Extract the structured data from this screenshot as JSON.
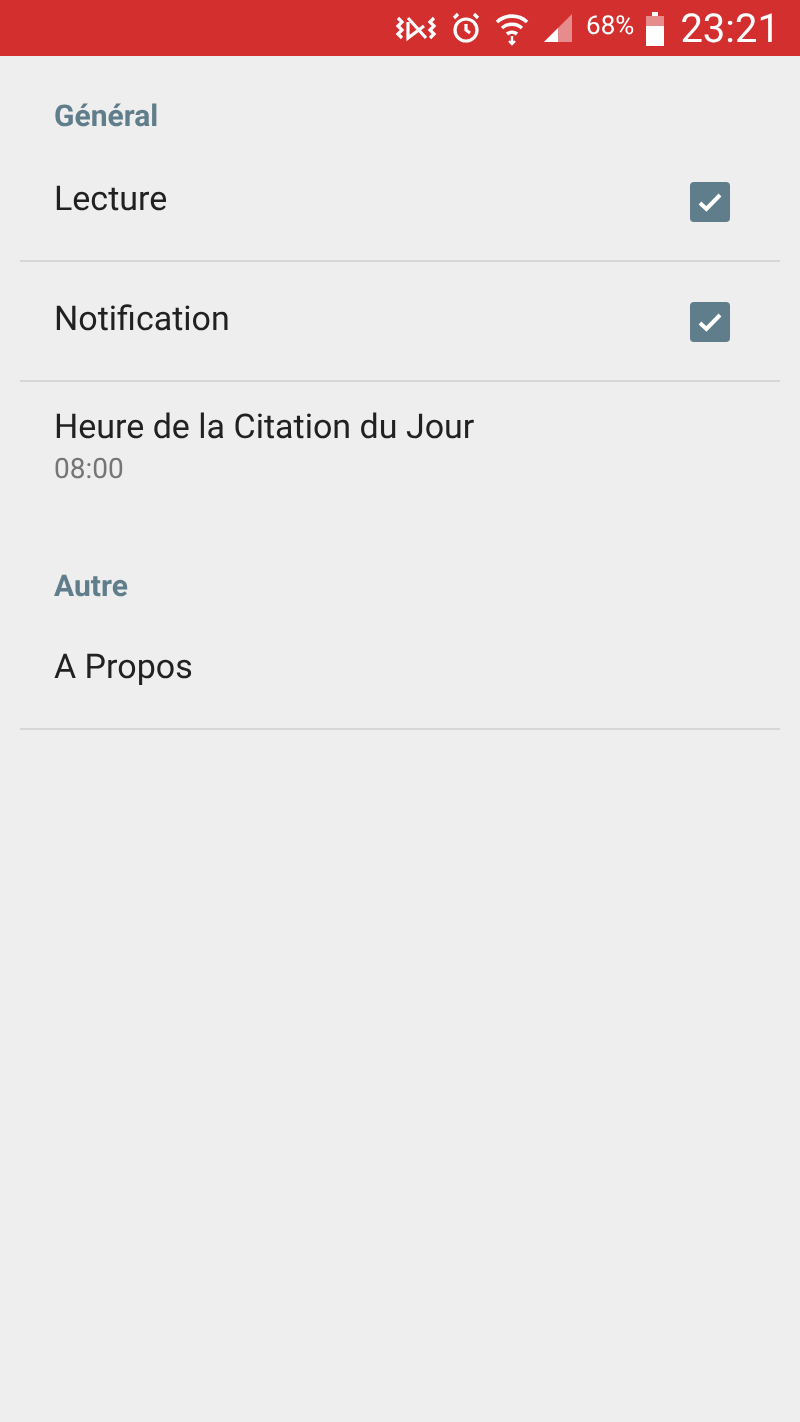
{
  "status_bar": {
    "battery_text": "68%",
    "time": "23:21"
  },
  "sections": [
    {
      "title": "Général",
      "items": [
        {
          "kind": "checkbox",
          "label": "Lecture",
          "checked": true,
          "divider": true
        },
        {
          "kind": "checkbox",
          "label": "Notification",
          "checked": true,
          "divider": true
        },
        {
          "kind": "subtitle",
          "label": "Heure de la Citation du Jour",
          "summary": "08:00",
          "divider": false
        }
      ]
    },
    {
      "title": "Autre",
      "items": [
        {
          "kind": "plain",
          "label": "A Propos",
          "divider": true
        }
      ]
    }
  ]
}
